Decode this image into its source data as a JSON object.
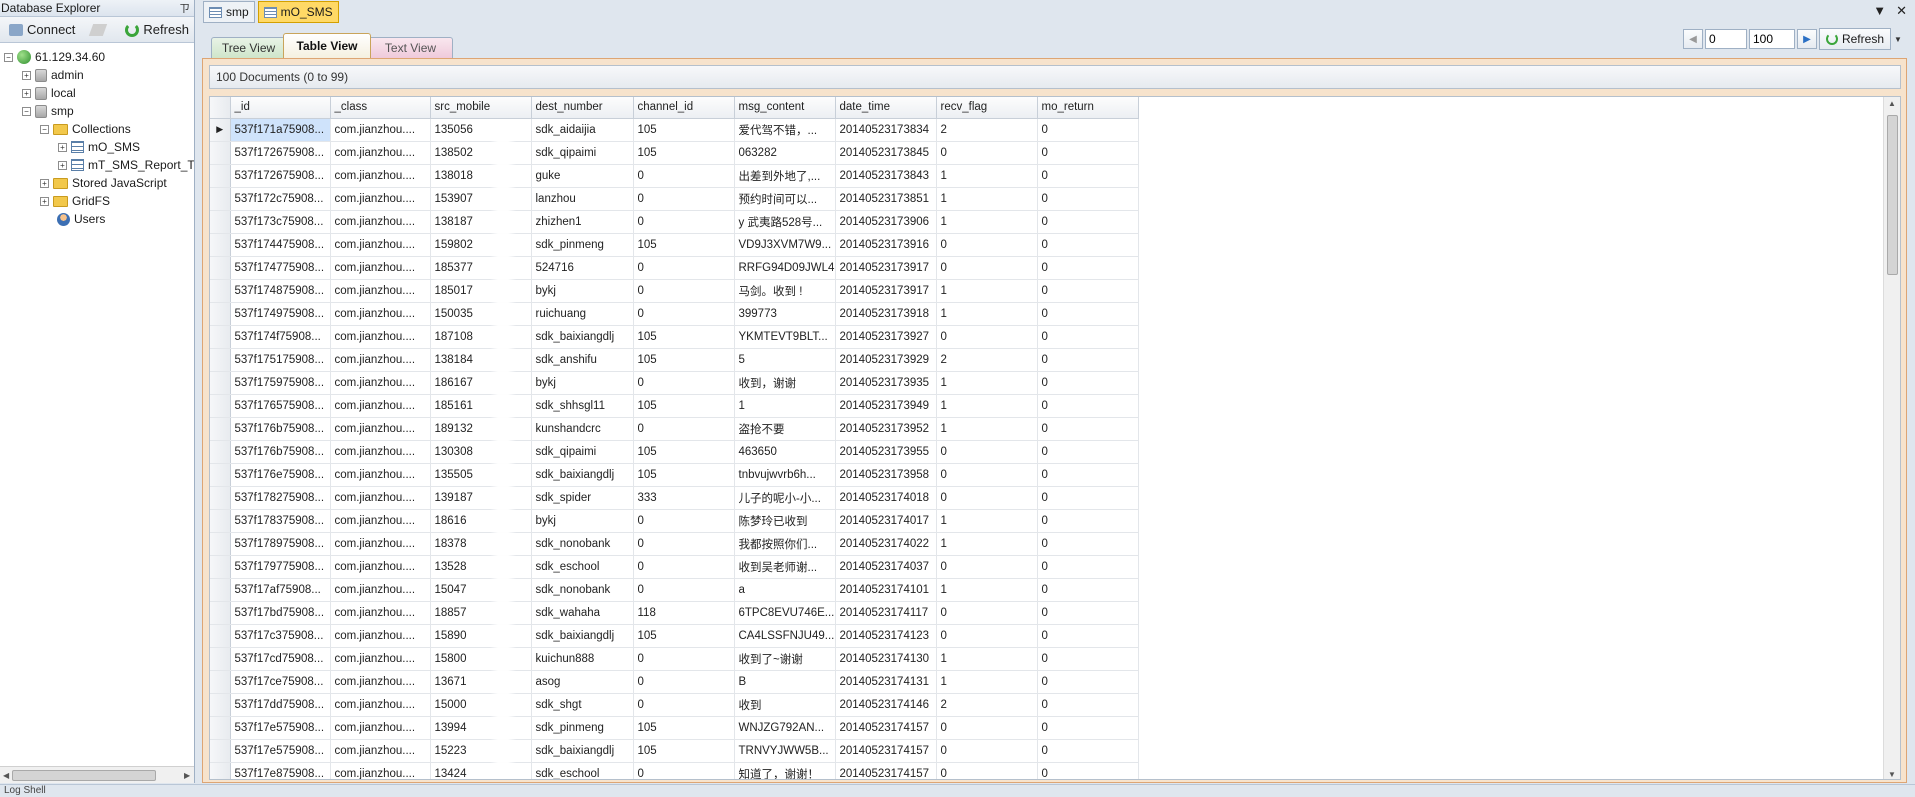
{
  "left_panel": {
    "title": "Database Explorer",
    "pin": "ㄗ",
    "toolbar": {
      "connect_label": "Connect",
      "refresh_label": "Refresh"
    },
    "tree": {
      "server": "61.129.34.60",
      "dbs": [
        "admin",
        "local",
        "smp"
      ],
      "collections_label": "Collections",
      "collections": [
        "mO_SMS",
        "mT_SMS_Report_T"
      ],
      "stored_js": "Stored JavaScript",
      "gridfs": "GridFS",
      "users": "Users"
    },
    "scroll_grip": "III"
  },
  "doc_tabs": [
    "smp",
    "mO_SMS"
  ],
  "window_controls": {
    "pin": "▼",
    "close": "✕"
  },
  "view_tabs": [
    "Tree View",
    "Table View",
    "Text View"
  ],
  "pager": {
    "start": "0",
    "limit": "100",
    "refresh_label": "Refresh"
  },
  "doc_count": "100 Documents (0 to 99)",
  "grid": {
    "columns": [
      "_id",
      "_class",
      "src_mobile",
      "dest_number",
      "channel_id",
      "msg_content",
      "date_time",
      "recv_flag",
      "mo_return"
    ],
    "rows": [
      [
        "537f171a75908...",
        "com.jianzhou....",
        "135056",
        "sdk_aidaijia",
        "105",
        "爱代驾不错，...",
        "20140523173834",
        "2",
        "0"
      ],
      [
        "537f172675908...",
        "com.jianzhou....",
        "138502",
        "sdk_qipaimi",
        "105",
        "063282",
        "20140523173845",
        "0",
        "0"
      ],
      [
        "537f172675908...",
        "com.jianzhou....",
        "138018",
        "guke",
        "0",
        "出差到外地了,...",
        "20140523173843",
        "1",
        "0"
      ],
      [
        "537f172c75908...",
        "com.jianzhou....",
        "153907",
        "lanzhou",
        "0",
        "预约时间可以...",
        "20140523173851",
        "1",
        "0"
      ],
      [
        "537f173c75908...",
        "com.jianzhou....",
        "138187",
        "zhizhen1",
        "0",
        "y 武夷路528号...",
        "20140523173906",
        "1",
        "0"
      ],
      [
        "537f174475908...",
        "com.jianzhou....",
        "159802",
        "sdk_pinmeng",
        "105",
        "VD9J3XVM7W9...",
        "20140523173916",
        "0",
        "0"
      ],
      [
        "537f174775908...",
        "com.jianzhou....",
        "185377",
        "524716",
        "0",
        "RRFG94D09JWL4",
        "20140523173917",
        "0",
        "0"
      ],
      [
        "537f174875908...",
        "com.jianzhou....",
        "185017",
        "bykj",
        "0",
        "马剑。收到 !",
        "20140523173917",
        "1",
        "0"
      ],
      [
        "537f174975908...",
        "com.jianzhou....",
        "150035",
        "ruichuang",
        "0",
        "399773",
        "20140523173918",
        "1",
        "0"
      ],
      [
        "537f174f75908...",
        "com.jianzhou....",
        "187108",
        "sdk_baixiangdlj",
        "105",
        "YKMTEVT9BLT...",
        "20140523173927",
        "0",
        "0"
      ],
      [
        "537f175175908...",
        "com.jianzhou....",
        "138184",
        "sdk_anshifu",
        "105",
        "5",
        "20140523173929",
        "2",
        "0"
      ],
      [
        "537f175975908...",
        "com.jianzhou....",
        "186167",
        "bykj",
        "0",
        "收到，谢谢",
        "20140523173935",
        "1",
        "0"
      ],
      [
        "537f176575908...",
        "com.jianzhou....",
        "185161",
        "sdk_shhsgl11",
        "105",
        "1",
        "20140523173949",
        "1",
        "0"
      ],
      [
        "537f176b75908...",
        "com.jianzhou....",
        "189132",
        "kunshandcrc",
        "0",
        "盗抢不要",
        "20140523173952",
        "1",
        "0"
      ],
      [
        "537f176b75908...",
        "com.jianzhou....",
        "130308",
        "sdk_qipaimi",
        "105",
        "463650",
        "20140523173955",
        "0",
        "0"
      ],
      [
        "537f176e75908...",
        "com.jianzhou....",
        "135505",
        "sdk_baixiangdlj",
        "105",
        "tnbvujwvrb6h...",
        "20140523173958",
        "0",
        "0"
      ],
      [
        "537f178275908...",
        "com.jianzhou....",
        "139187",
        "sdk_spider",
        "333",
        "儿子的呢小-小...",
        "20140523174018",
        "0",
        "0"
      ],
      [
        "537f178375908...",
        "com.jianzhou....",
        "18616",
        "bykj",
        "0",
        "陈梦玲已收到",
        "20140523174017",
        "1",
        "0"
      ],
      [
        "537f178975908...",
        "com.jianzhou....",
        "18378",
        "sdk_nonobank",
        "0",
        "我都按照你们...",
        "20140523174022",
        "1",
        "0"
      ],
      [
        "537f179775908...",
        "com.jianzhou....",
        "13528",
        "sdk_eschool",
        "0",
        "收到吴老师谢...",
        "20140523174037",
        "0",
        "0"
      ],
      [
        "537f17af75908...",
        "com.jianzhou....",
        "15047",
        "sdk_nonobank",
        "0",
        "a",
        "20140523174101",
        "1",
        "0"
      ],
      [
        "537f17bd75908...",
        "com.jianzhou....",
        "18857",
        "sdk_wahaha",
        "118",
        "6TPC8EVU746E...",
        "20140523174117",
        "0",
        "0"
      ],
      [
        "537f17c375908...",
        "com.jianzhou....",
        "15890",
        "sdk_baixiangdlj",
        "105",
        "CA4LSSFNJU49...",
        "20140523174123",
        "0",
        "0"
      ],
      [
        "537f17cd75908...",
        "com.jianzhou....",
        "15800",
        "kuichun888",
        "0",
        "收到了~谢谢",
        "20140523174130",
        "1",
        "0"
      ],
      [
        "537f17ce75908...",
        "com.jianzhou....",
        "13671",
        "asog",
        "0",
        "B",
        "20140523174131",
        "1",
        "0"
      ],
      [
        "537f17dd75908...",
        "com.jianzhou....",
        "15000",
        "sdk_shgt",
        "0",
        "收到",
        "20140523174146",
        "2",
        "0"
      ],
      [
        "537f17e575908...",
        "com.jianzhou....",
        "13994",
        "sdk_pinmeng",
        "105",
        "WNJZG792AN...",
        "20140523174157",
        "0",
        "0"
      ],
      [
        "537f17e575908...",
        "com.jianzhou....",
        "15223",
        "sdk_baixiangdlj",
        "105",
        "TRNVYJWW5B...",
        "20140523174157",
        "0",
        "0"
      ],
      [
        "537f17e875908...",
        "com.jianzhou....",
        "13424",
        "sdk_eschool",
        "0",
        "知道了，谢谢！",
        "20140523174157",
        "0",
        "0"
      ]
    ]
  },
  "status_text": "Log Shell"
}
